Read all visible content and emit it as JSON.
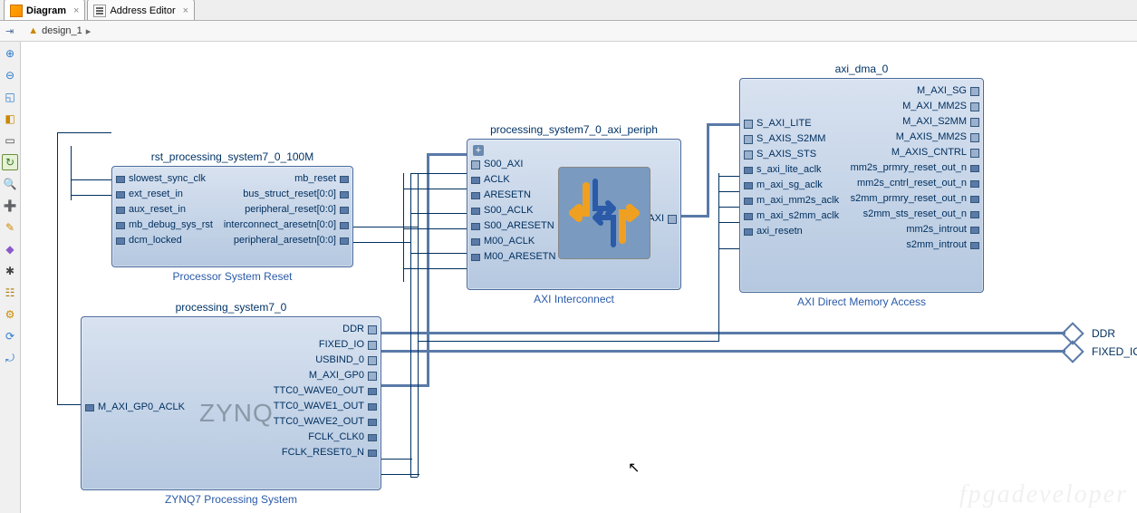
{
  "tabs": [
    {
      "label": "Diagram",
      "active": true
    },
    {
      "label": "Address Editor",
      "active": false
    }
  ],
  "breadcrumb": {
    "design": "design_1"
  },
  "toolbar_tips": [
    "collapse",
    "zoom-in",
    "zoom-out",
    "zoom-fit",
    "zoom-select",
    "select",
    "area",
    "validate",
    "search",
    "add-ip",
    "wizard",
    "bug",
    "tree",
    "settings",
    "refresh",
    "reload",
    "config"
  ],
  "blocks": {
    "rst": {
      "title": "rst_processing_system7_0_100M",
      "caption": "Processor System Reset",
      "left_ports": [
        "slowest_sync_clk",
        "ext_reset_in",
        "aux_reset_in",
        "mb_debug_sys_rst",
        "dcm_locked"
      ],
      "right_ports": [
        "mb_reset",
        "bus_struct_reset[0:0]",
        "peripheral_reset[0:0]",
        "interconnect_aresetn[0:0]",
        "peripheral_aresetn[0:0]"
      ]
    },
    "ps7": {
      "title": "processing_system7_0",
      "caption": "ZYNQ7 Processing System",
      "logo": "ZYNQ",
      "left_ports": [
        "M_AXI_GP0_ACLK"
      ],
      "right_ports": [
        "DDR",
        "FIXED_IO",
        "USBIND_0",
        "M_AXI_GP0",
        "TTC0_WAVE0_OUT",
        "TTC0_WAVE1_OUT",
        "TTC0_WAVE2_OUT",
        "FCLK_CLK0",
        "FCLK_RESET0_N"
      ]
    },
    "axi_ic": {
      "title": "processing_system7_0_axi_periph",
      "caption": "AXI Interconnect",
      "left_ports": [
        "S00_AXI",
        "ACLK",
        "ARESETN",
        "S00_ACLK",
        "S00_ARESETN",
        "M00_ACLK",
        "M00_ARESETN"
      ],
      "right_ports": [
        "M00_AXI"
      ]
    },
    "dma": {
      "title": "axi_dma_0",
      "caption": "AXI Direct Memory Access",
      "left_ports": [
        "S_AXI_LITE",
        "S_AXIS_S2MM",
        "S_AXIS_STS",
        "s_axi_lite_aclk",
        "m_axi_sg_aclk",
        "m_axi_mm2s_aclk",
        "m_axi_s2mm_aclk",
        "axi_resetn"
      ],
      "right_ports": [
        "M_AXI_SG",
        "M_AXI_MM2S",
        "M_AXI_S2MM",
        "M_AXIS_MM2S",
        "M_AXIS_CNTRL",
        "mm2s_prmry_reset_out_n",
        "mm2s_cntrl_reset_out_n",
        "s2mm_prmry_reset_out_n",
        "s2mm_sts_reset_out_n",
        "mm2s_introut",
        "s2mm_introut"
      ]
    }
  },
  "ext_ports": [
    "DDR",
    "FIXED_IO"
  ],
  "watermark": "fpgadeveloper"
}
